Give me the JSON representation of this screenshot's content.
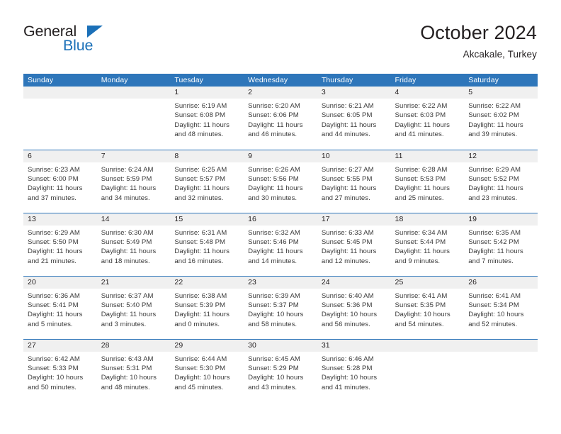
{
  "logo": {
    "word_one": "General",
    "word_two": "Blue",
    "triangle_color": "#1b70b8",
    "text_color": "#231f20"
  },
  "header": {
    "title": "October 2024",
    "subtitle": "Akcakale, Turkey"
  },
  "theme": {
    "header_blue": "#2e76ba",
    "daynum_band": "#f0f0f0",
    "body_text": "#3a3a3a"
  },
  "calendar": {
    "weekday_headers": [
      "Sunday",
      "Monday",
      "Tuesday",
      "Wednesday",
      "Thursday",
      "Friday",
      "Saturday"
    ],
    "weeks": [
      [
        {
          "day": "",
          "empty": true,
          "sunrise": "",
          "sunset": "",
          "daylight_1": "",
          "daylight_2": ""
        },
        {
          "day": "",
          "empty": true,
          "sunrise": "",
          "sunset": "",
          "daylight_1": "",
          "daylight_2": ""
        },
        {
          "day": "1",
          "sunrise": "Sunrise: 6:19 AM",
          "sunset": "Sunset: 6:08 PM",
          "daylight_1": "Daylight: 11 hours",
          "daylight_2": "and 48 minutes."
        },
        {
          "day": "2",
          "sunrise": "Sunrise: 6:20 AM",
          "sunset": "Sunset: 6:06 PM",
          "daylight_1": "Daylight: 11 hours",
          "daylight_2": "and 46 minutes."
        },
        {
          "day": "3",
          "sunrise": "Sunrise: 6:21 AM",
          "sunset": "Sunset: 6:05 PM",
          "daylight_1": "Daylight: 11 hours",
          "daylight_2": "and 44 minutes."
        },
        {
          "day": "4",
          "sunrise": "Sunrise: 6:22 AM",
          "sunset": "Sunset: 6:03 PM",
          "daylight_1": "Daylight: 11 hours",
          "daylight_2": "and 41 minutes."
        },
        {
          "day": "5",
          "sunrise": "Sunrise: 6:22 AM",
          "sunset": "Sunset: 6:02 PM",
          "daylight_1": "Daylight: 11 hours",
          "daylight_2": "and 39 minutes."
        }
      ],
      [
        {
          "day": "6",
          "sunrise": "Sunrise: 6:23 AM",
          "sunset": "Sunset: 6:00 PM",
          "daylight_1": "Daylight: 11 hours",
          "daylight_2": "and 37 minutes."
        },
        {
          "day": "7",
          "sunrise": "Sunrise: 6:24 AM",
          "sunset": "Sunset: 5:59 PM",
          "daylight_1": "Daylight: 11 hours",
          "daylight_2": "and 34 minutes."
        },
        {
          "day": "8",
          "sunrise": "Sunrise: 6:25 AM",
          "sunset": "Sunset: 5:57 PM",
          "daylight_1": "Daylight: 11 hours",
          "daylight_2": "and 32 minutes."
        },
        {
          "day": "9",
          "sunrise": "Sunrise: 6:26 AM",
          "sunset": "Sunset: 5:56 PM",
          "daylight_1": "Daylight: 11 hours",
          "daylight_2": "and 30 minutes."
        },
        {
          "day": "10",
          "sunrise": "Sunrise: 6:27 AM",
          "sunset": "Sunset: 5:55 PM",
          "daylight_1": "Daylight: 11 hours",
          "daylight_2": "and 27 minutes."
        },
        {
          "day": "11",
          "sunrise": "Sunrise: 6:28 AM",
          "sunset": "Sunset: 5:53 PM",
          "daylight_1": "Daylight: 11 hours",
          "daylight_2": "and 25 minutes."
        },
        {
          "day": "12",
          "sunrise": "Sunrise: 6:29 AM",
          "sunset": "Sunset: 5:52 PM",
          "daylight_1": "Daylight: 11 hours",
          "daylight_2": "and 23 minutes."
        }
      ],
      [
        {
          "day": "13",
          "sunrise": "Sunrise: 6:29 AM",
          "sunset": "Sunset: 5:50 PM",
          "daylight_1": "Daylight: 11 hours",
          "daylight_2": "and 21 minutes."
        },
        {
          "day": "14",
          "sunrise": "Sunrise: 6:30 AM",
          "sunset": "Sunset: 5:49 PM",
          "daylight_1": "Daylight: 11 hours",
          "daylight_2": "and 18 minutes."
        },
        {
          "day": "15",
          "sunrise": "Sunrise: 6:31 AM",
          "sunset": "Sunset: 5:48 PM",
          "daylight_1": "Daylight: 11 hours",
          "daylight_2": "and 16 minutes."
        },
        {
          "day": "16",
          "sunrise": "Sunrise: 6:32 AM",
          "sunset": "Sunset: 5:46 PM",
          "daylight_1": "Daylight: 11 hours",
          "daylight_2": "and 14 minutes."
        },
        {
          "day": "17",
          "sunrise": "Sunrise: 6:33 AM",
          "sunset": "Sunset: 5:45 PM",
          "daylight_1": "Daylight: 11 hours",
          "daylight_2": "and 12 minutes."
        },
        {
          "day": "18",
          "sunrise": "Sunrise: 6:34 AM",
          "sunset": "Sunset: 5:44 PM",
          "daylight_1": "Daylight: 11 hours",
          "daylight_2": "and 9 minutes."
        },
        {
          "day": "19",
          "sunrise": "Sunrise: 6:35 AM",
          "sunset": "Sunset: 5:42 PM",
          "daylight_1": "Daylight: 11 hours",
          "daylight_2": "and 7 minutes."
        }
      ],
      [
        {
          "day": "20",
          "sunrise": "Sunrise: 6:36 AM",
          "sunset": "Sunset: 5:41 PM",
          "daylight_1": "Daylight: 11 hours",
          "daylight_2": "and 5 minutes."
        },
        {
          "day": "21",
          "sunrise": "Sunrise: 6:37 AM",
          "sunset": "Sunset: 5:40 PM",
          "daylight_1": "Daylight: 11 hours",
          "daylight_2": "and 3 minutes."
        },
        {
          "day": "22",
          "sunrise": "Sunrise: 6:38 AM",
          "sunset": "Sunset: 5:39 PM",
          "daylight_1": "Daylight: 11 hours",
          "daylight_2": "and 0 minutes."
        },
        {
          "day": "23",
          "sunrise": "Sunrise: 6:39 AM",
          "sunset": "Sunset: 5:37 PM",
          "daylight_1": "Daylight: 10 hours",
          "daylight_2": "and 58 minutes."
        },
        {
          "day": "24",
          "sunrise": "Sunrise: 6:40 AM",
          "sunset": "Sunset: 5:36 PM",
          "daylight_1": "Daylight: 10 hours",
          "daylight_2": "and 56 minutes."
        },
        {
          "day": "25",
          "sunrise": "Sunrise: 6:41 AM",
          "sunset": "Sunset: 5:35 PM",
          "daylight_1": "Daylight: 10 hours",
          "daylight_2": "and 54 minutes."
        },
        {
          "day": "26",
          "sunrise": "Sunrise: 6:41 AM",
          "sunset": "Sunset: 5:34 PM",
          "daylight_1": "Daylight: 10 hours",
          "daylight_2": "and 52 minutes."
        }
      ],
      [
        {
          "day": "27",
          "sunrise": "Sunrise: 6:42 AM",
          "sunset": "Sunset: 5:33 PM",
          "daylight_1": "Daylight: 10 hours",
          "daylight_2": "and 50 minutes."
        },
        {
          "day": "28",
          "sunrise": "Sunrise: 6:43 AM",
          "sunset": "Sunset: 5:31 PM",
          "daylight_1": "Daylight: 10 hours",
          "daylight_2": "and 48 minutes."
        },
        {
          "day": "29",
          "sunrise": "Sunrise: 6:44 AM",
          "sunset": "Sunset: 5:30 PM",
          "daylight_1": "Daylight: 10 hours",
          "daylight_2": "and 45 minutes."
        },
        {
          "day": "30",
          "sunrise": "Sunrise: 6:45 AM",
          "sunset": "Sunset: 5:29 PM",
          "daylight_1": "Daylight: 10 hours",
          "daylight_2": "and 43 minutes."
        },
        {
          "day": "31",
          "sunrise": "Sunrise: 6:46 AM",
          "sunset": "Sunset: 5:28 PM",
          "daylight_1": "Daylight: 10 hours",
          "daylight_2": "and 41 minutes."
        },
        {
          "day": "",
          "empty": true,
          "sunrise": "",
          "sunset": "",
          "daylight_1": "",
          "daylight_2": ""
        },
        {
          "day": "",
          "empty": true,
          "sunrise": "",
          "sunset": "",
          "daylight_1": "",
          "daylight_2": ""
        }
      ]
    ]
  }
}
